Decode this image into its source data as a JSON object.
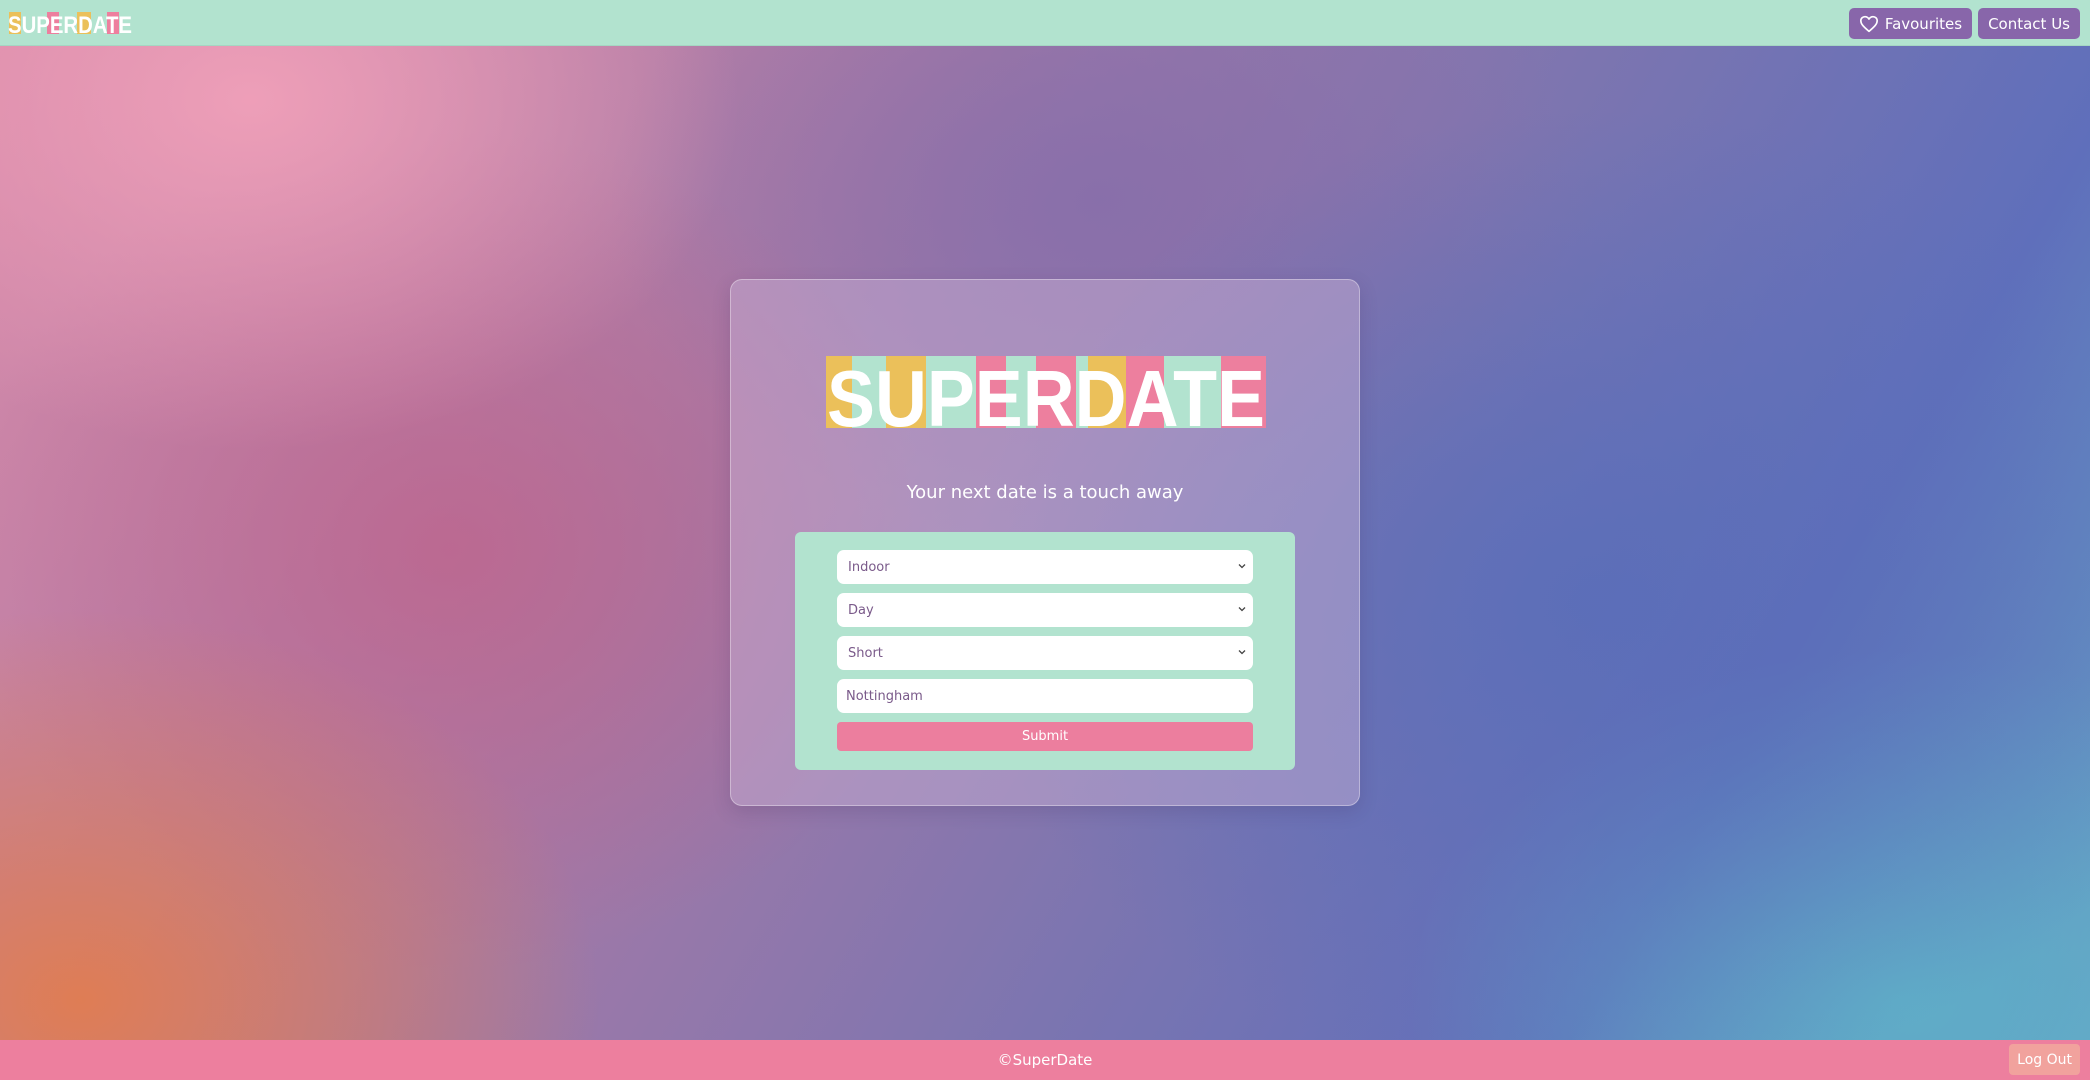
{
  "header": {
    "logo_text": "SUPERDATE",
    "nav": {
      "favourites_label": "Favourites",
      "contact_label": "Contact Us"
    }
  },
  "main": {
    "logo_text": "SUPERDATE",
    "tagline": "Your next date is a touch away",
    "form": {
      "setting": {
        "value": "Indoor"
      },
      "time_of_day": {
        "value": "Day"
      },
      "duration": {
        "value": "Short"
      },
      "location": {
        "value": "Nottingham"
      },
      "submit_label": "Submit"
    }
  },
  "footer": {
    "copyright": "©SuperDate",
    "logout_label": "Log Out"
  },
  "icons": {
    "favourites": "heart-outline-icon",
    "select_arrow": "chevron-down-icon"
  },
  "colors": {
    "nav_bg": "#b2e3cf",
    "nav_button": "#8866aa",
    "accent_pink": "#ed7f9e",
    "accent_yellow": "#ebc05a",
    "accent_mint": "#b2e3cf",
    "logout_button": "#f1a29d"
  }
}
